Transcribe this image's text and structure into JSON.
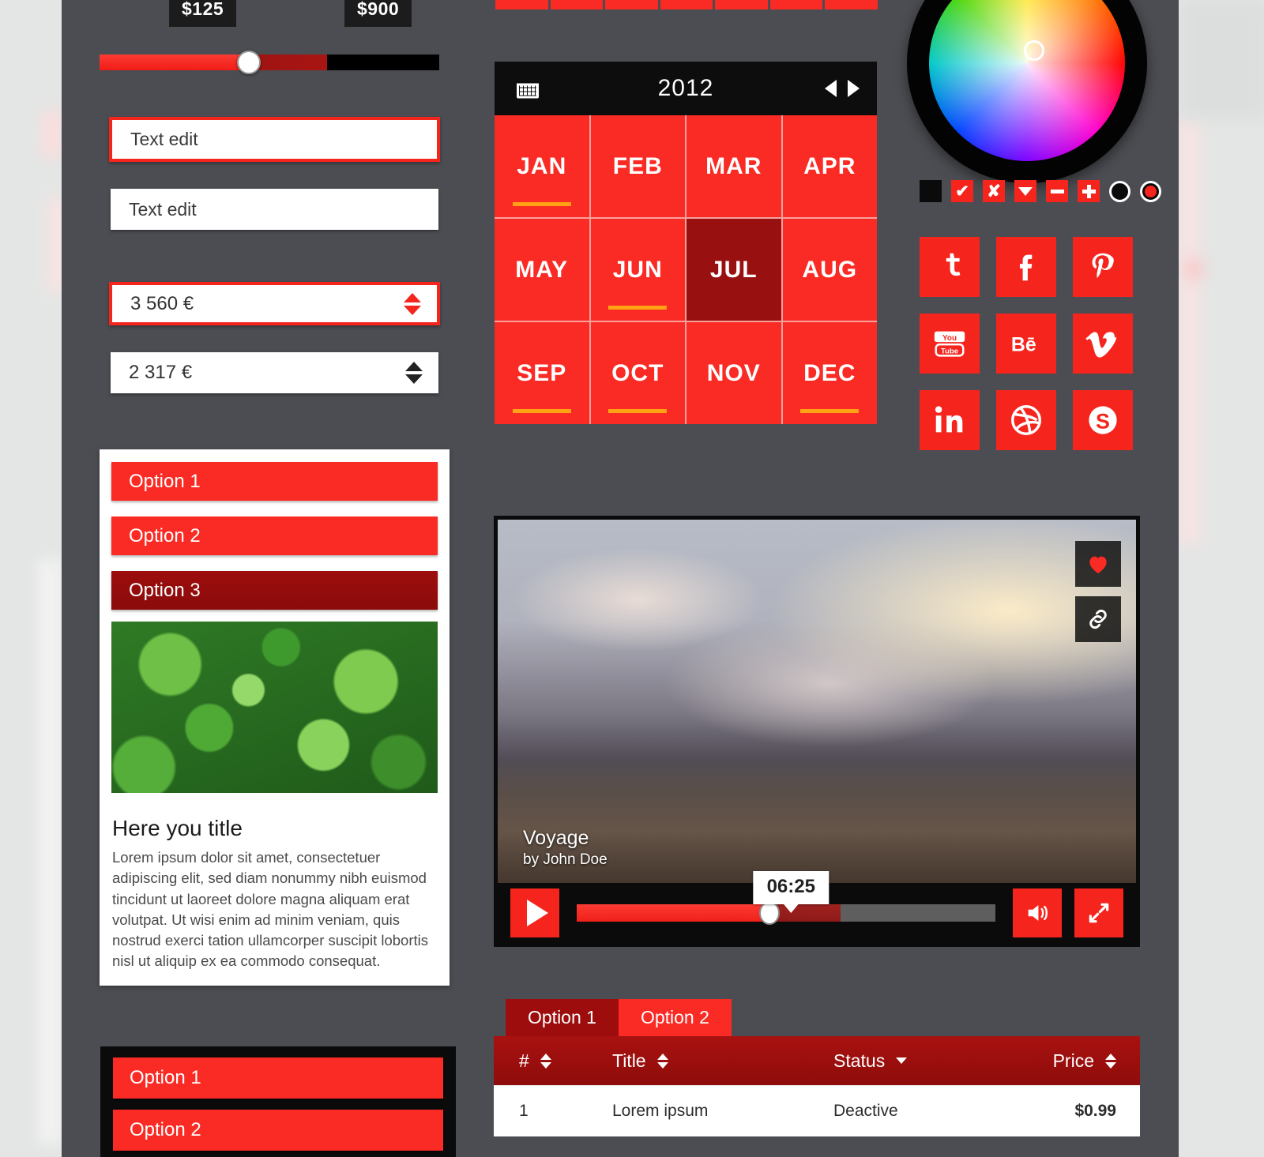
{
  "theme": {
    "accent_red": "#fa2a24",
    "dark_red": "#991010",
    "panel_bg": "#4b4d52",
    "page_bg": "#e4e6e5",
    "black": "#0b0b0b",
    "marker_orange": "#ffa214"
  },
  "range_slider": {
    "min_label": "$125",
    "max_label": "$900",
    "fill_percent": 44,
    "buffer_percent": 67
  },
  "text_fields": [
    {
      "value": "Text edit",
      "state": "focused"
    },
    {
      "value": "Text edit",
      "state": "normal"
    }
  ],
  "spinners": [
    {
      "value": "3 560 €",
      "state": "focused"
    },
    {
      "value": "2 317 €",
      "state": "normal"
    }
  ],
  "calendar": {
    "icon": "calendar-icon",
    "year": "2012",
    "prev_icon": "chevron-left-icon",
    "next_icon": "chevron-right-icon",
    "selected": "JUL",
    "months": [
      {
        "label": "JAN",
        "marked": true
      },
      {
        "label": "FEB",
        "marked": false
      },
      {
        "label": "MAR",
        "marked": false
      },
      {
        "label": "APR",
        "marked": false
      },
      {
        "label": "MAY",
        "marked": false
      },
      {
        "label": "JUN",
        "marked": true
      },
      {
        "label": "JUL",
        "marked": false
      },
      {
        "label": "AUG",
        "marked": false
      },
      {
        "label": "SEP",
        "marked": true
      },
      {
        "label": "OCT",
        "marked": true
      },
      {
        "label": "NOV",
        "marked": false
      },
      {
        "label": "DEC",
        "marked": true
      }
    ]
  },
  "color_picker": {
    "name": "color-wheel",
    "handle": "color-wheel-handle"
  },
  "toggles": [
    {
      "name": "checkbox-empty",
      "glyph": ""
    },
    {
      "name": "checkbox-checked",
      "glyph": "✔"
    },
    {
      "name": "checkbox-close",
      "glyph": "✘"
    },
    {
      "name": "dropdown-caret",
      "glyph": ""
    },
    {
      "name": "minus-button",
      "glyph": ""
    },
    {
      "name": "plus-button",
      "glyph": ""
    },
    {
      "name": "radio-unselected",
      "glyph": ""
    },
    {
      "name": "radio-selected",
      "glyph": ""
    }
  ],
  "social": [
    {
      "name": "twitter-icon",
      "label": "Twitter"
    },
    {
      "name": "facebook-icon",
      "label": "Facebook"
    },
    {
      "name": "pinterest-icon",
      "label": "Pinterest"
    },
    {
      "name": "youtube-icon",
      "label": "YouTube"
    },
    {
      "name": "behance-icon",
      "label": "Behance"
    },
    {
      "name": "vimeo-icon",
      "label": "Vimeo"
    },
    {
      "name": "linkedin-icon",
      "label": "LinkedIn"
    },
    {
      "name": "dribbble-icon",
      "label": "Dribbble"
    },
    {
      "name": "skype-icon",
      "label": "Skype"
    }
  ],
  "card": {
    "options": [
      {
        "label": "Option 1",
        "state": "normal"
      },
      {
        "label": "Option 2",
        "state": "normal"
      },
      {
        "label": "Option 3",
        "state": "selected"
      }
    ],
    "image_alt": "green-leaves-photo",
    "title": "Here you title",
    "body": "Lorem ipsum dolor sit amet, consectetuer adipiscing elit, sed diam nonummy nibh euismod tincidunt ut laoreet dolore magna aliquam erat volutpat. Ut wisi enim ad minim veniam, quis nostrud exerci tation ullamcorper suscipit lobortis nisl ut aliquip ex ea commodo consequat."
  },
  "video": {
    "image_alt": "clouds-over-mountains-photo",
    "title": "Voyage",
    "author": "by John Doe",
    "time": "06:25",
    "progress_percent": 46,
    "buffer_percent": 63,
    "like_icon": "heart-icon",
    "link_icon": "chain-link-icon",
    "play_icon": "play-icon",
    "volume_icon": "volume-icon",
    "fullscreen_icon": "fullscreen-icon"
  },
  "tabs": [
    {
      "label": "Option 1",
      "state": "inactive"
    },
    {
      "label": "Option 2",
      "state": "active"
    }
  ],
  "table": {
    "columns": [
      {
        "label": "#",
        "sort": "both"
      },
      {
        "label": "Title",
        "sort": "both"
      },
      {
        "label": "Status",
        "sort": "down"
      },
      {
        "label": "Price",
        "sort": "both"
      }
    ],
    "rows": [
      {
        "num": "1",
        "title": "Lorem ipsum",
        "status": "Deactive",
        "price": "$0.99"
      }
    ]
  },
  "dark_list": {
    "options": [
      {
        "label": "Option 1"
      },
      {
        "label": "Option 2"
      }
    ]
  }
}
